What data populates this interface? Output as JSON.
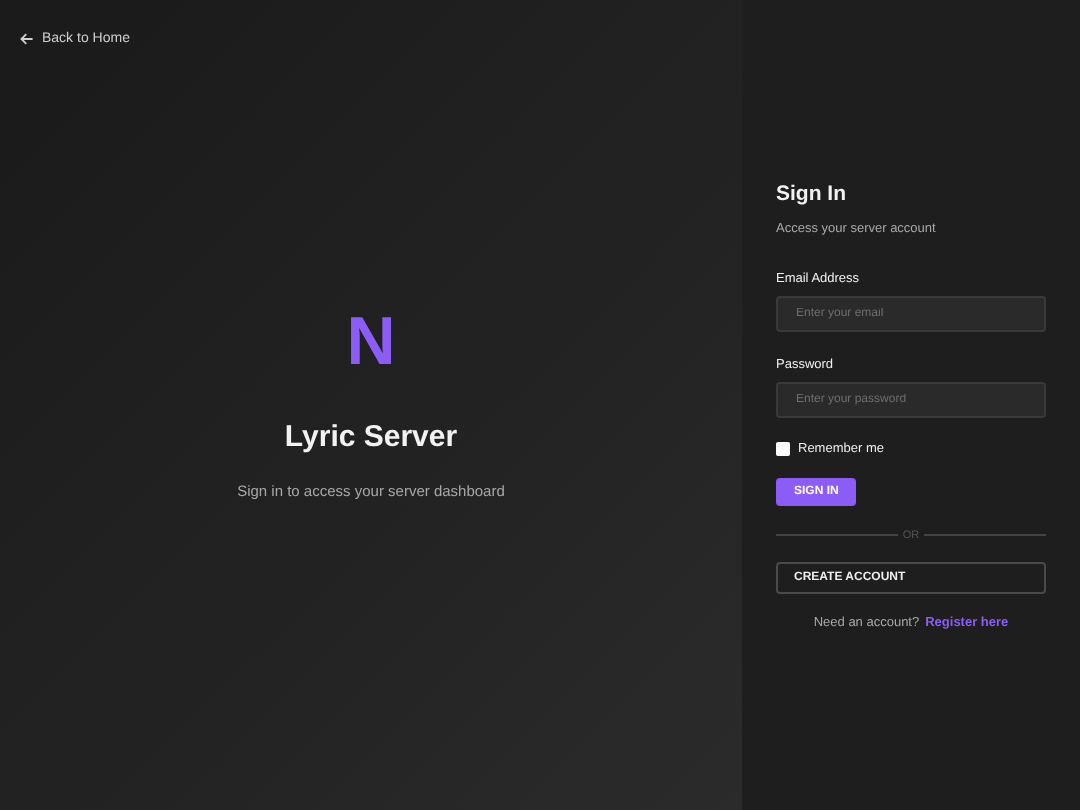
{
  "back_link": {
    "label": "Back to Home"
  },
  "brand": {
    "logo_letter": "N",
    "title": "Lyric Server",
    "subtitle": "Sign in to access your server dashboard"
  },
  "signin": {
    "title": "Sign In",
    "subtitle": "Access your server account",
    "fields": [
      {
        "label": "Email Address",
        "placeholder": "Enter your email"
      },
      {
        "label": "Password",
        "placeholder": "Enter your password"
      }
    ],
    "remember": {
      "label": "Remember me",
      "checked": false
    },
    "submit": "SIGN IN",
    "divider": "OR",
    "create_account": "CREATE ACCOUNT",
    "footer": {
      "text": "Need an account?",
      "link": "Register here"
    }
  }
}
